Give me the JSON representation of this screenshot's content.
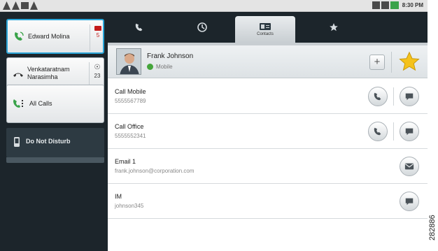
{
  "status_bar": {
    "time": "8:30 PM",
    "icons": [
      "usb-icon",
      "usb-icon",
      "sim-icon",
      "alert-icon",
      "phone-icon",
      "signal-icon",
      "battery-icon"
    ]
  },
  "sidebar": {
    "calls": [
      {
        "name": "Edward Molina",
        "badge_count": "5",
        "icon": "phone-active-icon",
        "badge_icon": "voicemail-icon",
        "active": true
      },
      {
        "name": "Venkataratnam Narasimha",
        "badge_count": "23",
        "icon": "phone-hangup-icon",
        "badge_icon": "presence-icon",
        "active": false
      }
    ],
    "all_calls_label": "All Calls",
    "dnd_label": "Do Not Disturb"
  },
  "tabs": [
    {
      "icon": "phone-icon",
      "label": ""
    },
    {
      "icon": "recent-calls-icon",
      "label": ""
    },
    {
      "icon": "contacts-icon",
      "label": "Contacts",
      "active": true
    },
    {
      "icon": "favorites-icon",
      "label": ""
    }
  ],
  "contact": {
    "name": "Frank Johnson",
    "presence": "Mobile",
    "add_label": "+"
  },
  "rows": [
    {
      "title": "Call Mobile",
      "value": "5555567789",
      "actions": [
        "call-icon",
        "message-icon"
      ]
    },
    {
      "title": "Call Office",
      "value": "5555552341",
      "actions": [
        "call-icon",
        "message-icon"
      ]
    },
    {
      "title": "Email 1",
      "value": "frank.johnson@corporation.com",
      "actions": [
        "email-icon"
      ]
    },
    {
      "title": "IM",
      "value": "johnson345",
      "actions": [
        "message-icon"
      ]
    }
  ],
  "watermark": "282886",
  "colors": {
    "sidebar_bg": "#1c252b",
    "active_border": "#2aa5d8",
    "presence_green": "#45a53b",
    "star": "#f5c21b",
    "voicemail_red": "#c41a1a"
  }
}
